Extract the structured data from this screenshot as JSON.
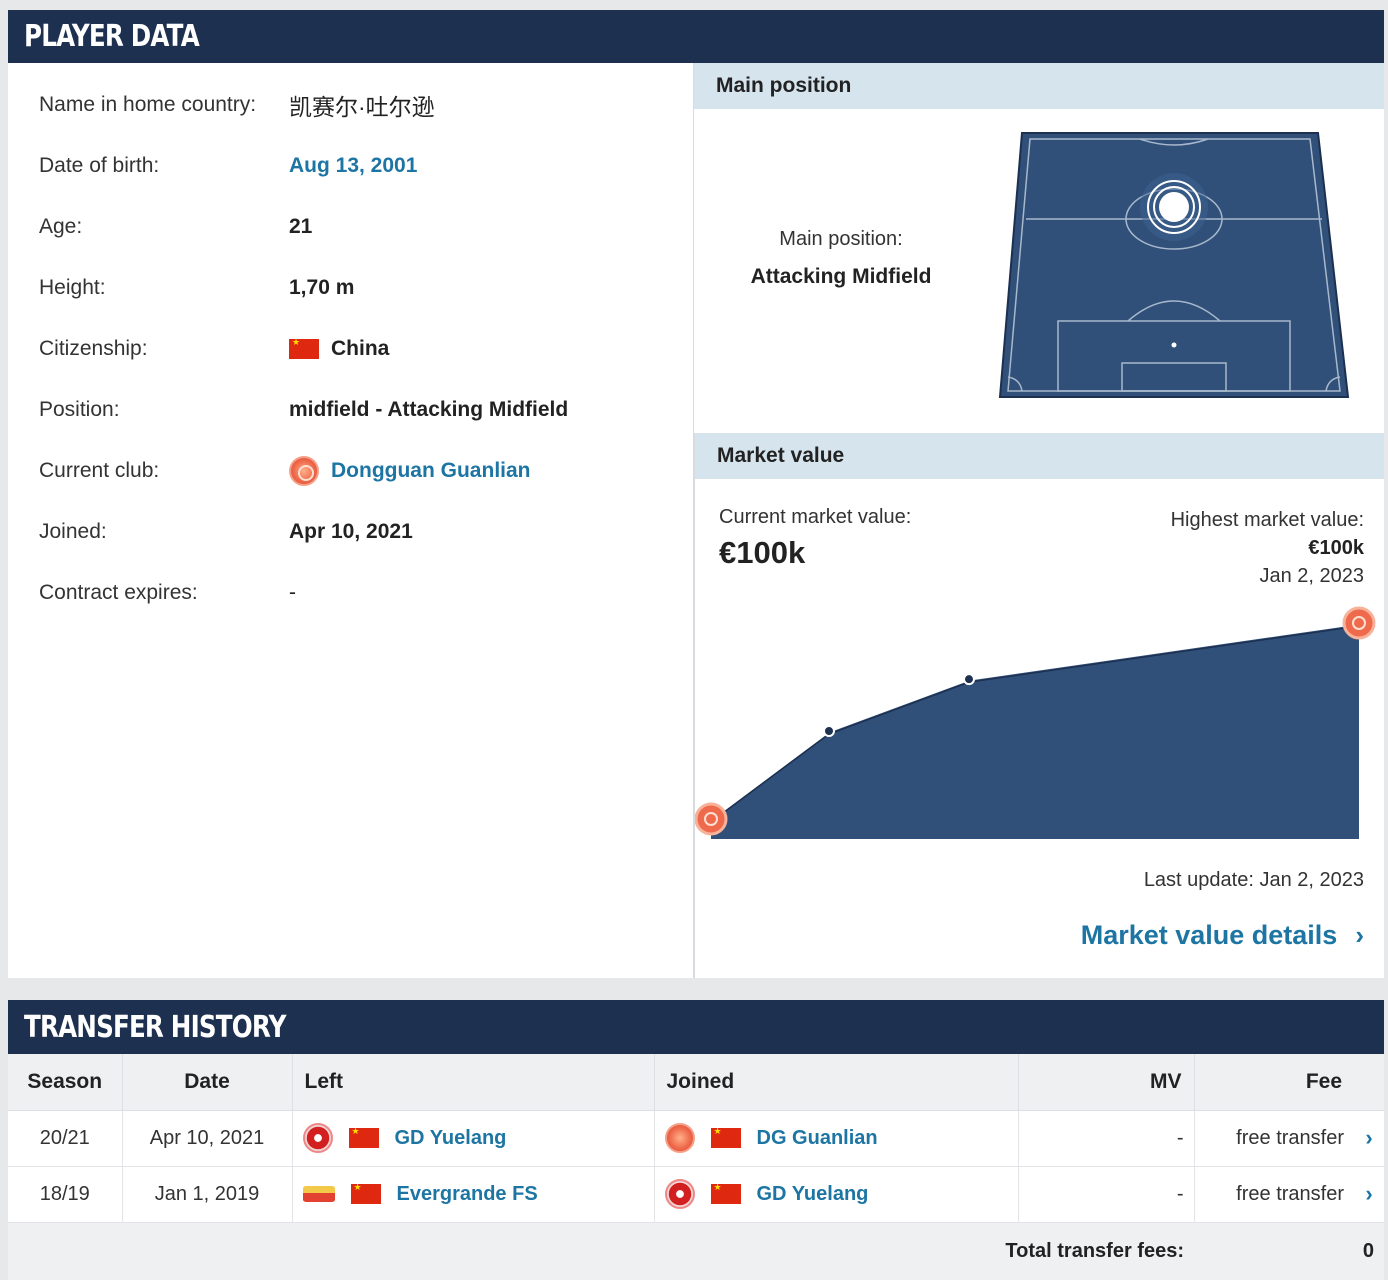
{
  "player_data": {
    "title": "PLAYER DATA",
    "rows": [
      {
        "label": "Name in home country:",
        "value": "凯赛尔·吐尔逊"
      },
      {
        "label": "Date of birth:",
        "value": "Aug 13, 2001"
      },
      {
        "label": "Age:",
        "value": "21"
      },
      {
        "label": "Height:",
        "value": "1,70 m"
      },
      {
        "label": "Citizenship:",
        "value": "China"
      },
      {
        "label": "Position:",
        "value": "midfield - Attacking Midfield"
      },
      {
        "label": "Current club:",
        "value": "Dongguan Guanlian"
      },
      {
        "label": "Joined:",
        "value": "Apr 10, 2021"
      },
      {
        "label": "Contract expires:",
        "value": "-"
      }
    ]
  },
  "main_position": {
    "header": "Main position",
    "label": "Main position:",
    "value": "Attacking Midfield"
  },
  "market_value": {
    "header": "Market value",
    "current_label": "Current market value:",
    "current_value": "€100k",
    "highest_label": "Highest market value:",
    "highest_value": "€100k",
    "highest_date": "Jan 2, 2023",
    "last_update": "Last update: Jan 2, 2023",
    "details_link": "Market value details",
    "chart_data": {
      "type": "area",
      "points": [
        0.0,
        0.5,
        0.74,
        1.0,
        1.0
      ],
      "point_markers": [
        "club-badge",
        "dot",
        "dot",
        "club-badge"
      ],
      "fill_color": "#30507a",
      "line_color": "#ffffff"
    }
  },
  "transfer_history": {
    "title": "TRANSFER HISTORY",
    "columns": {
      "season": "Season",
      "date": "Date",
      "left": "Left",
      "joined": "Joined",
      "mv": "MV",
      "fee": "Fee"
    },
    "rows": [
      {
        "season": "20/21",
        "date": "Apr 10, 2021",
        "left": "GD Yuelang",
        "joined": "DG Guanlian",
        "mv": "-",
        "fee": "free transfer"
      },
      {
        "season": "18/19",
        "date": "Jan 1, 2019",
        "left": "Evergrande FS",
        "joined": "GD Yuelang",
        "mv": "-",
        "fee": "free transfer"
      }
    ],
    "total_label": "Total transfer fees:",
    "total_value": "0"
  },
  "colors": {
    "header_bg": "#1d3050",
    "link": "#1d75a3",
    "subheader_bg": "#d6e4ee",
    "pitch": "#30507a"
  }
}
